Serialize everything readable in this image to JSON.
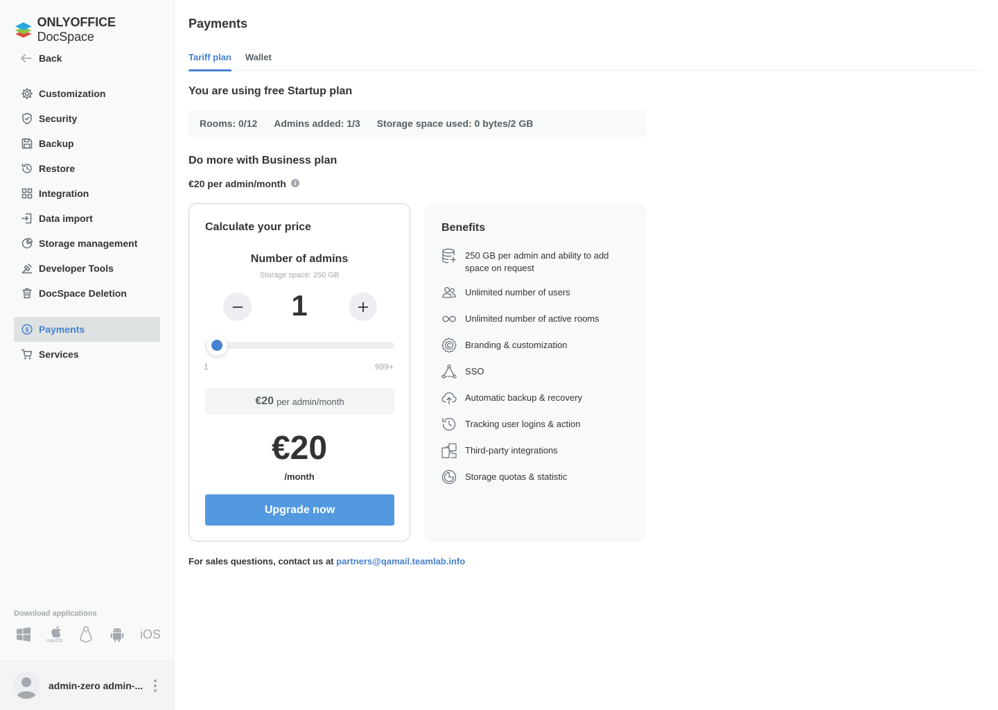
{
  "app": {
    "logo_brand": "ONLYOFFICE",
    "logo_product": "DocSpace"
  },
  "sidebar": {
    "back_label": "Back",
    "items": [
      {
        "label": "Customization",
        "icon": "gear-icon"
      },
      {
        "label": "Security",
        "icon": "shield-icon"
      },
      {
        "label": "Backup",
        "icon": "floppy-disk-icon"
      },
      {
        "label": "Restore",
        "icon": "history-icon"
      },
      {
        "label": "Integration",
        "icon": "grid-icon"
      },
      {
        "label": "Data import",
        "icon": "import-icon"
      },
      {
        "label": "Storage management",
        "icon": "pie-chart-icon"
      },
      {
        "label": "Developer Tools",
        "icon": "developer-tools-icon"
      },
      {
        "label": "DocSpace Deletion",
        "icon": "trash-icon"
      },
      {
        "label": "Payments",
        "icon": "payments-icon",
        "active": true
      },
      {
        "label": "Services",
        "icon": "cart-icon"
      }
    ],
    "download_title": "Download applications",
    "apps": [
      {
        "name": "windows-icon"
      },
      {
        "name": "macos-icon",
        "label": "macOS"
      },
      {
        "name": "linux-icon"
      },
      {
        "name": "android-icon"
      },
      {
        "name": "ios-icon",
        "label": "iOS"
      }
    ],
    "user_name": "admin-zero admin-..."
  },
  "main": {
    "title": "Payments",
    "tabs": [
      {
        "label": "Tariff plan",
        "active": true
      },
      {
        "label": "Wallet",
        "active": false
      }
    ],
    "current_plan": "You are using free Startup plan",
    "usage": {
      "rooms": "Rooms: 0/12",
      "admins": "Admins added: 1/3",
      "storage": "Storage space used: 0 bytes/2 GB"
    },
    "upsell_title": "Do more with Business plan",
    "price_per_admin": "€20 per admin/month",
    "calculator": {
      "title": "Calculate your price",
      "admins_label": "Number of admins",
      "storage_note": "Storage space: 250 GB",
      "count": "1",
      "slider_min": "1",
      "slider_max": "999+",
      "slider_value_fraction": 0,
      "per_admin_price": "€20",
      "per_admin_suffix": "per admin/month",
      "total": "€20",
      "period": "/month",
      "upgrade_label": "Upgrade now"
    },
    "benefits": {
      "title": "Benefits",
      "items": [
        {
          "text": "250 GB per admin and ability to add space on request",
          "icon": "database-icon"
        },
        {
          "text": "Unlimited number of users",
          "icon": "users-icon"
        },
        {
          "text": "Unlimited number of active rooms",
          "icon": "infinity-icon"
        },
        {
          "text": "Branding & customization",
          "icon": "branding-icon"
        },
        {
          "text": "SSO",
          "icon": "sso-icon"
        },
        {
          "text": "Automatic backup & recovery",
          "icon": "cloud-upload-icon"
        },
        {
          "text": "Tracking user logins & action",
          "icon": "history-icon"
        },
        {
          "text": "Third-party integrations",
          "icon": "puzzle-icon"
        },
        {
          "text": "Storage quotas & statistic",
          "icon": "pie-chart-icon"
        }
      ]
    },
    "contact": {
      "text": "For sales questions, contact us at",
      "email": "partners@qamail.teamlab.info"
    }
  },
  "colors": {
    "accent": "#4781d1",
    "button": "#5299e0",
    "active_bg": "#dfe2e3"
  }
}
